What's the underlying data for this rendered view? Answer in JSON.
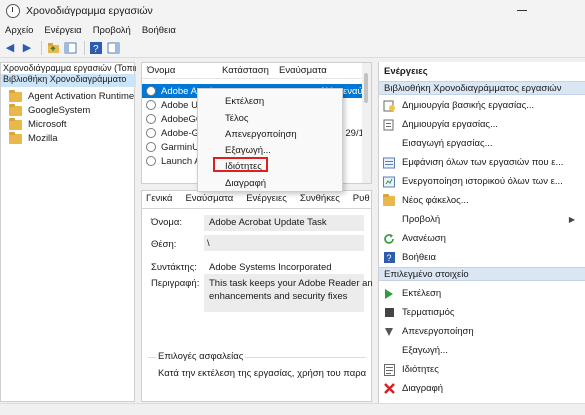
{
  "window": {
    "title": "Χρονοδιάγραμμα εργασιών"
  },
  "menu": [
    "Αρχείο",
    "Ενέργεια",
    "Προβολή",
    "Βοήθεια"
  ],
  "toolbar": [
    "back-icon",
    "forward-icon",
    "folder-up-icon",
    "console-tree-icon",
    "help-icon",
    "action-pane-icon"
  ],
  "tree": {
    "top": "Χρονοδιάγραμμα εργασιών (Τοπικ",
    "root": "Βιβλιοθήκη Χρονοδιαγράμματο",
    "nodes": [
      "Agent Activation Runtime",
      "GoogleSystem",
      "Microsoft",
      "Mozilla"
    ]
  },
  "tasklist": {
    "headers": [
      "Όνομα",
      "Κατάσταση",
      "Εναύσματα"
    ],
    "rows": [
      {
        "name": "Adobe Acrob",
        "extra": "άλλα εναύ",
        "selected": true
      },
      {
        "name": "Adobe Un",
        "extra": "",
        "selected": false
      },
      {
        "name": "AdobeGC",
        "extra": "",
        "selected": false
      },
      {
        "name": "Adobe-Ge",
        "extra": "ν 29/1",
        "selected": false
      },
      {
        "name": "GarminUp",
        "extra": "",
        "selected": false
      },
      {
        "name": "Launch Ad",
        "extra": "",
        "selected": false
      }
    ]
  },
  "context_menu": {
    "items": [
      "Εκτέλεση",
      "Τέλος",
      "Απενεργοποίηση",
      "Εξαγωγή...",
      "Ιδιότητες",
      "Διαγραφή"
    ],
    "highlighted": "Ιδιότητες"
  },
  "details": {
    "tabs": [
      "Γενικά",
      "Εναύσματα",
      "Ενέργειες",
      "Συνθήκες",
      "Ρυθ"
    ],
    "name_label": "Όνομα:",
    "name_value": "Adobe Acrobat Update Task",
    "location_label": "Θέση:",
    "location_value": "\\",
    "author_label": "Συντάκτης:",
    "author_value": "Adobe Systems Incorporated",
    "desc_label": "Περιγραφή:",
    "desc_line1": "This task keeps your Adobe Reader an",
    "desc_line2": "enhancements and security fixes",
    "security_label": "Επιλογές ασφαλείας",
    "security_text": "Κατά την εκτέλεση της εργασίας, χρήση του παρα"
  },
  "actions": {
    "header": "Ενέργειες",
    "section1": "Βιβλιοθήκη Χρονοδιαγράμματος εργασιών",
    "items1": [
      {
        "label": "Δημιουργία βασικής εργασίας...",
        "icon": "basic-task-icon"
      },
      {
        "label": "Δημιουργία εργασίας...",
        "icon": "create-task-icon"
      },
      {
        "label": "Εισαγωγή εργασίας...",
        "icon": ""
      },
      {
        "label": "Εμφάνιση όλων των εργασιών που ε...",
        "icon": "running-tasks-icon"
      },
      {
        "label": "Ενεργοποίηση ιστορικού όλων των ε...",
        "icon": "history-icon"
      },
      {
        "label": "Νέος φάκελος...",
        "icon": "new-folder-icon"
      },
      {
        "label": "Προβολή",
        "icon": "",
        "submenu": true
      },
      {
        "label": "Ανανέωση",
        "icon": "refresh-icon"
      },
      {
        "label": "Βοήθεια",
        "icon": "help-icon"
      }
    ],
    "section2": "Επιλεγμένο στοιχείο",
    "items2": [
      {
        "label": "Εκτέλεση",
        "icon": "run-icon"
      },
      {
        "label": "Τερματισμός",
        "icon": "stop-icon"
      },
      {
        "label": "Απενεργοποίηση",
        "icon": "disable-icon"
      },
      {
        "label": "Εξαγωγή...",
        "icon": ""
      },
      {
        "label": "Ιδιότητες",
        "icon": "properties-icon"
      },
      {
        "label": "Διαγραφή",
        "icon": "delete-icon"
      }
    ]
  },
  "colors": {
    "selection": "#0078d7",
    "highlight_box": "#e02020",
    "delete": "#d32020",
    "run": "#2e9e3c"
  }
}
